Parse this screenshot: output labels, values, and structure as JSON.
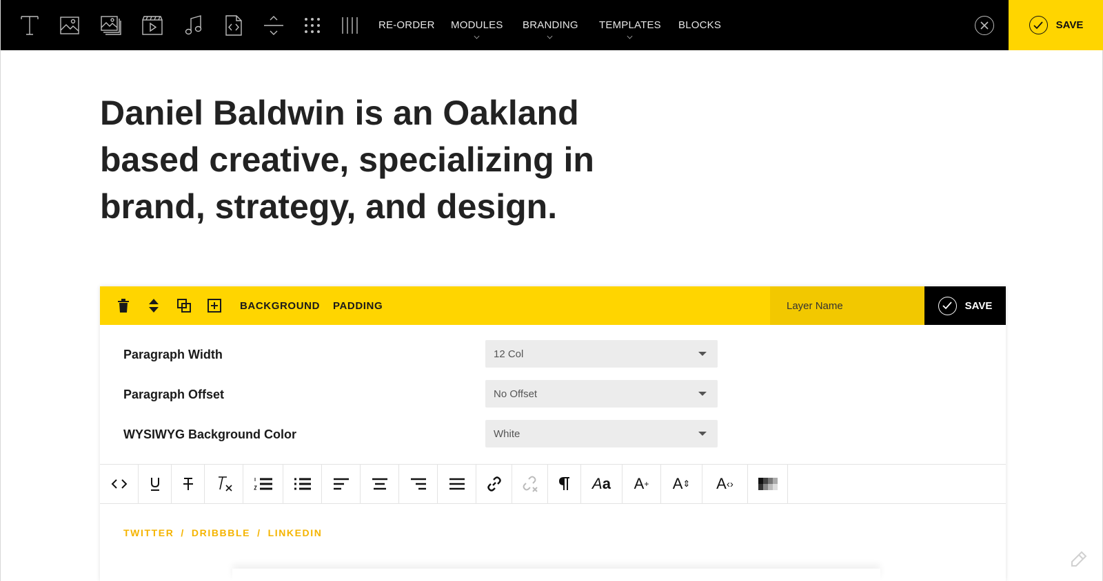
{
  "topbar": {
    "tools": [
      {
        "icon": "text-icon"
      },
      {
        "icon": "image-icon"
      },
      {
        "icon": "gallery-icon"
      },
      {
        "icon": "video-icon"
      },
      {
        "icon": "audio-icon"
      },
      {
        "icon": "code-icon"
      },
      {
        "icon": "spacer-icon"
      },
      {
        "icon": "grid-icon"
      },
      {
        "icon": "columns-icon"
      }
    ],
    "nav": [
      {
        "label": "RE-ORDER",
        "has_caret": false
      },
      {
        "label": "MODULES",
        "has_caret": true
      },
      {
        "label": "BRANDING",
        "has_caret": true
      },
      {
        "label": "TEMPLATES",
        "has_caret": true
      },
      {
        "label": "BLOCKS",
        "has_caret": false
      }
    ],
    "save_label": "SAVE"
  },
  "headline": "Daniel Baldwin is an Oakland based creative, specializing in brand, strategy, and design.",
  "panel": {
    "actions": [
      "trash-icon",
      "reorder-icon",
      "duplicate-icon",
      "add-icon"
    ],
    "links": [
      "BACKGROUND",
      "PADDING"
    ],
    "layer_name_placeholder": "Layer Name",
    "save_label": "SAVE",
    "fields": [
      {
        "label": "Paragraph Width",
        "value": "12 Col"
      },
      {
        "label": "Paragraph Offset",
        "value": "No Offset"
      },
      {
        "label": "WYSIWYG Background Color",
        "value": "White"
      }
    ],
    "editor_tools": [
      "source-code-icon",
      "underline-icon",
      "strikethrough-icon",
      "clear-format-icon",
      "ordered-list-icon",
      "bullet-list-icon",
      "align-left-icon",
      "align-center-icon",
      "align-right-icon",
      "justify-icon",
      "link-icon",
      "unlink-icon",
      "paragraph-icon",
      "font-family-icon",
      "font-size-icon",
      "line-height-icon",
      "letter-spacing-icon",
      "color-swatch-icon"
    ],
    "social": [
      "TWITTER",
      "DRIBBBLE",
      "LINKEDIN"
    ],
    "social_sep": "/"
  },
  "colors": {
    "accent": "#FFD500",
    "accent_dark": "#F2C800",
    "link": "#F5B400",
    "bar": "#000000"
  }
}
